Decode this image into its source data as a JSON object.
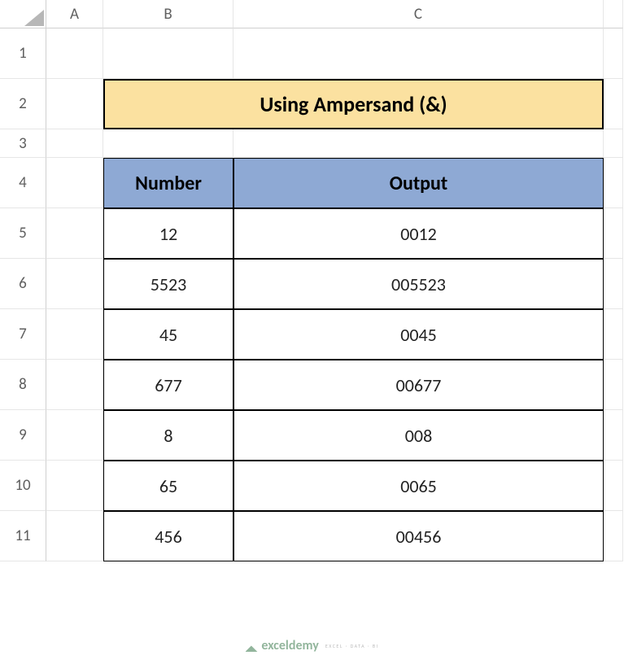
{
  "columns": [
    "A",
    "B",
    "C"
  ],
  "rows": [
    "1",
    "2",
    "3",
    "4",
    "5",
    "6",
    "7",
    "8",
    "9",
    "10",
    "11"
  ],
  "title": "Using Ampersand (&)",
  "headers": {
    "number": "Number",
    "output": "Output"
  },
  "data": [
    {
      "number": "12",
      "output": "0012"
    },
    {
      "number": "5523",
      "output": "005523"
    },
    {
      "number": "45",
      "output": "0045"
    },
    {
      "number": "677",
      "output": "00677"
    },
    {
      "number": "8",
      "output": "008"
    },
    {
      "number": "65",
      "output": "0065"
    },
    {
      "number": "456",
      "output": "00456"
    }
  ],
  "watermark": {
    "brand": "exceldemy",
    "tagline": "EXCEL · DATA · BI"
  },
  "chart_data": {
    "type": "table",
    "title": "Using Ampersand (&)",
    "columns": [
      "Number",
      "Output"
    ],
    "rows": [
      [
        "12",
        "0012"
      ],
      [
        "5523",
        "005523"
      ],
      [
        "45",
        "0045"
      ],
      [
        "677",
        "00677"
      ],
      [
        "8",
        "008"
      ],
      [
        "65",
        "0065"
      ],
      [
        "456",
        "00456"
      ]
    ]
  }
}
